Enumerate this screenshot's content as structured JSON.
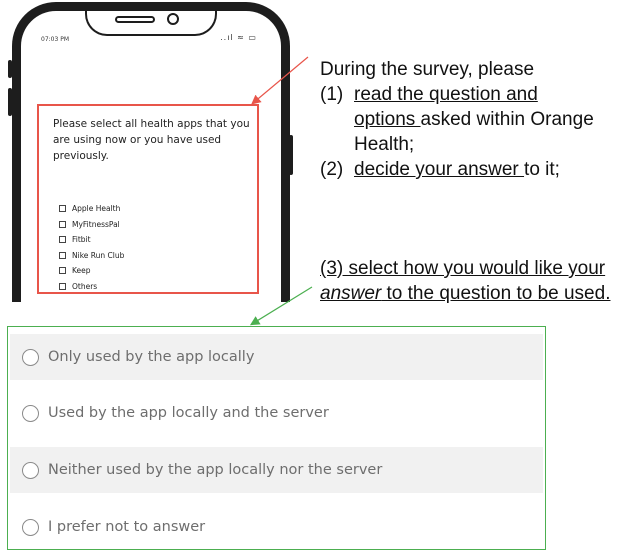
{
  "phone": {
    "status_time": "07:03 PM",
    "status_icons": "..ıl ≈ ▭",
    "question": "Please select all health apps that you are using now or you have used previously.",
    "apps": [
      "Apple Health",
      "MyFitnessPal",
      "Fitbit",
      "Nike Run Club",
      "Keep",
      "Others"
    ]
  },
  "annotation": {
    "line1": "During the survey, please",
    "s1_num": "(1)",
    "s1_a": "read the question and",
    "s1_b": "options ",
    "s1_c": "asked within Orange",
    "s1_d": "Health;",
    "s2_num": "(2)",
    "s2_a": "decide your answer ",
    "s2_b": "to it;",
    "s3_a": "(3) select how you would like your",
    "s3_b": "answer",
    "s3_c": " to the question to be used."
  },
  "options": [
    "Only used by the app locally",
    "Used by the app locally and the server",
    "Neither used by the app locally nor the server",
    "I prefer not to answer"
  ],
  "colors": {
    "highlight_red": "#e8554a",
    "panel_green": "#4caf50",
    "option_text": "#6e6e6e"
  }
}
